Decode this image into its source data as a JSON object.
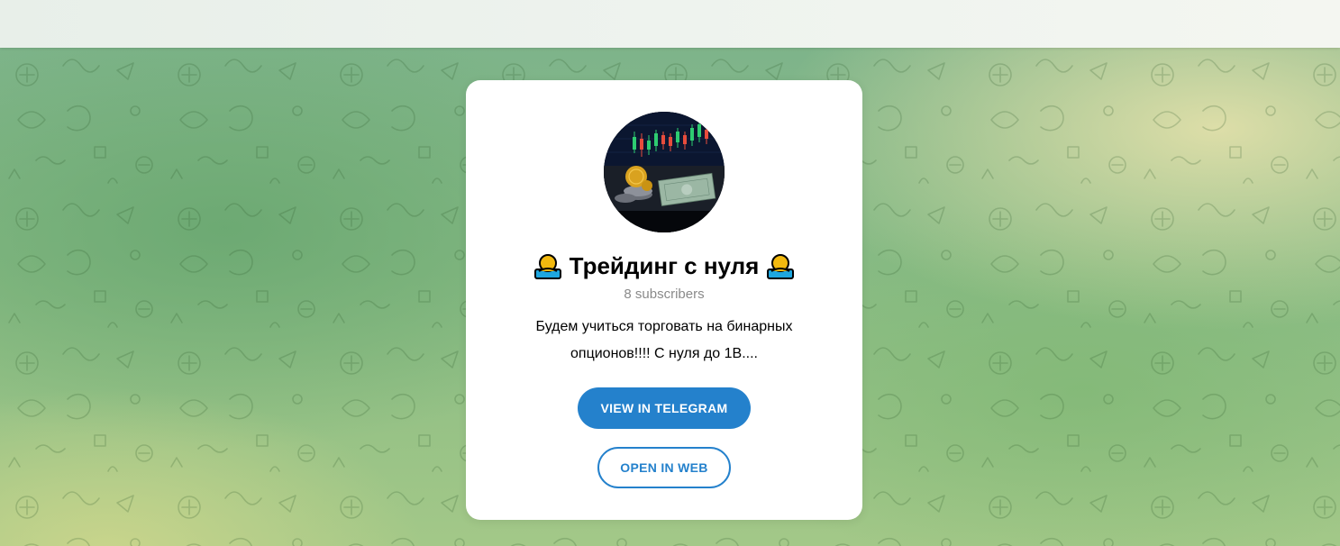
{
  "channel": {
    "title": "Трейдинг с нуля",
    "title_emoji_left": "bust-in-silhouette-emoji",
    "title_emoji_right": "bust-in-silhouette-emoji",
    "subscribers": "8 subscribers",
    "description": "Будем учиться торговать на бинарных опционов!!!! С нуля до 1В....",
    "avatar": "trading-chart-with-coins-avatar"
  },
  "actions": {
    "view_in_telegram": "VIEW IN TELEGRAM",
    "open_in_web": "OPEN IN WEB"
  },
  "colors": {
    "accent": "#2481cc",
    "card_background": "#ffffff",
    "subtitle_text": "#8a8a8a"
  }
}
